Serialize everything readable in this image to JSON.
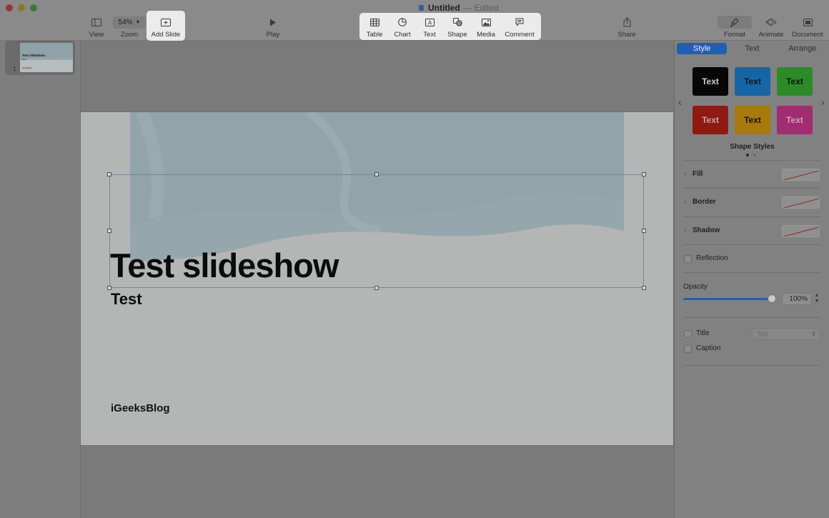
{
  "window": {
    "title": "Untitled",
    "separator": "—",
    "status": "Edited"
  },
  "toolbar": {
    "view": "View",
    "zoom_value": "54%",
    "zoom": "Zoom",
    "add_slide": "Add Slide",
    "play": "Play",
    "table": "Table",
    "chart": "Chart",
    "text": "Text",
    "shape": "Shape",
    "media": "Media",
    "comment": "Comment",
    "share": "Share",
    "format": "Format",
    "animate": "Animate",
    "document": "Document"
  },
  "navigator": {
    "slides": [
      {
        "number": "1",
        "title": "Test slideshow",
        "subtitle": "Test",
        "footer": "iGeeksBlog"
      }
    ]
  },
  "slide": {
    "title": "Test slideshow",
    "subtitle": "Test",
    "footer": "iGeeksBlog"
  },
  "inspector": {
    "tabs": [
      "Style",
      "Text",
      "Arrange"
    ],
    "active_tab": "Style",
    "shape_styles": [
      {
        "label": "Text",
        "bg": "#070707",
        "fg": "#cfcfcf"
      },
      {
        "label": "Text",
        "bg": "#1566a6",
        "fg": "#111111"
      },
      {
        "label": "Text",
        "bg": "#2d8b26",
        "fg": "#111111"
      },
      {
        "label": "Text",
        "bg": "#8e1a12",
        "fg": "#c4a8a3"
      },
      {
        "label": "Text",
        "bg": "#a77a09",
        "fg": "#111111"
      },
      {
        "label": "Text",
        "bg": "#a22c70",
        "fg": "#c7a4b8"
      }
    ],
    "shape_styles_label": "Shape Styles",
    "fill": "Fill",
    "border": "Border",
    "shadow": "Shadow",
    "reflection": "Reflection",
    "opacity_label": "Opacity",
    "opacity_value": "100%",
    "opacity_level": 1.0,
    "title_label": "Title",
    "title_position": "Top",
    "caption_label": "Caption"
  },
  "colors": {
    "accent": "#215fb4",
    "highlight": "#ebebeb"
  }
}
